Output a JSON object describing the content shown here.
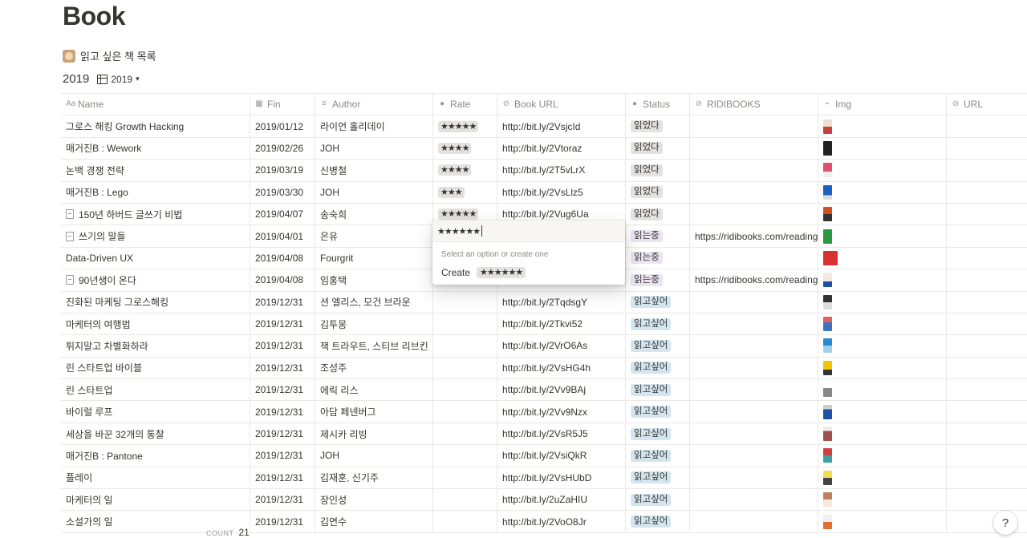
{
  "page": {
    "title": "Book",
    "description": "읽고 싶은 책 목록",
    "view_name": "2019",
    "view_switch": "2019"
  },
  "columns": [
    "Name",
    "Fin",
    "Author",
    "Rate",
    "Book URL",
    "Status",
    "RIDIBOOKS",
    "Img",
    "URL"
  ],
  "header_icons": [
    "text-icon",
    "calendar-icon",
    "text-lines-icon",
    "select-icon",
    "link-icon",
    "select-icon",
    "link-icon",
    "attachment-icon",
    "link-icon"
  ],
  "rows": [
    {
      "name": "그로스 해킹 Growth Hacking",
      "fin": "2019/01/12",
      "author": "라이언 홀리데이",
      "rate": "★★★★★",
      "url": "http://bit.ly/2VsjcId",
      "status": "읽었다",
      "status_type": "read",
      "ridi": "",
      "doc": false
    },
    {
      "name": "매거진B : Wework",
      "fin": "2019/02/26",
      "author": "JOH",
      "rate": "★★★★",
      "url": "http://bit.ly/2Vtoraz",
      "status": "읽었다",
      "status_type": "read",
      "ridi": "",
      "doc": false
    },
    {
      "name": "논백 경쟁 전략",
      "fin": "2019/03/19",
      "author": "신병철",
      "rate": "★★★★",
      "url": "http://bit.ly/2T5vLrX",
      "status": "읽었다",
      "status_type": "read",
      "ridi": "",
      "doc": false
    },
    {
      "name": "매거진B : Lego",
      "fin": "2019/03/30",
      "author": "JOH",
      "rate": "★★★",
      "url": "http://bit.ly/2VsLlz5",
      "status": "읽었다",
      "status_type": "read",
      "ridi": "",
      "doc": false
    },
    {
      "name": "150년 하버드 글쓰기 비법",
      "fin": "2019/04/07",
      "author": "송숙희",
      "rate": "★★★★★",
      "url": "http://bit.ly/2Vug6Ua",
      "status": "읽었다",
      "status_type": "read",
      "ridi": "",
      "doc": true
    },
    {
      "name": "쓰기의 말들",
      "fin": "2019/04/01",
      "author": "은유",
      "rate": "",
      "url": "",
      "status": "읽는중",
      "status_type": "reading",
      "ridi": "https://ridibooks.com/reading",
      "doc": true
    },
    {
      "name": "Data-Driven UX",
      "fin": "2019/04/08",
      "author": "Fourgrit",
      "rate": "",
      "url": "",
      "status": "읽는중",
      "status_type": "reading",
      "ridi": "",
      "doc": false
    },
    {
      "name": "90년생이 온다",
      "fin": "2019/04/08",
      "author": "임홍택",
      "rate": "",
      "url": "",
      "status": "읽는중",
      "status_type": "reading",
      "ridi": "https://ridibooks.com/reading",
      "doc": true
    },
    {
      "name": "진화된 마케팅 그로스해킹",
      "fin": "2019/12/31",
      "author": "션 엘리스, 모건 브라운",
      "rate": "",
      "url": "http://bit.ly/2TqdsgY",
      "status": "읽고싶어",
      "status_type": "want",
      "ridi": "",
      "doc": false
    },
    {
      "name": "마케터의 여행법",
      "fin": "2019/12/31",
      "author": "김투몽",
      "rate": "",
      "url": "http://bit.ly/2Tkvi52",
      "status": "읽고싶어",
      "status_type": "want",
      "ridi": "",
      "doc": false
    },
    {
      "name": "튀지말고 차별화하라",
      "fin": "2019/12/31",
      "author": "잭 트라우트, 스티브 리브킨",
      "rate": "",
      "url": "http://bit.ly/2VrO6As",
      "status": "읽고싶어",
      "status_type": "want",
      "ridi": "",
      "doc": false
    },
    {
      "name": "린 스타트업 바이블",
      "fin": "2019/12/31",
      "author": "조성주",
      "rate": "",
      "url": "http://bit.ly/2VsHG4h",
      "status": "읽고싶어",
      "status_type": "want",
      "ridi": "",
      "doc": false
    },
    {
      "name": "린 스타트업",
      "fin": "2019/12/31",
      "author": "에릭 리스",
      "rate": "",
      "url": "http://bit.ly/2Vv9BAj",
      "status": "읽고싶어",
      "status_type": "want",
      "ridi": "",
      "doc": false
    },
    {
      "name": "바이럴 루프",
      "fin": "2019/12/31",
      "author": "아담 페넨버그",
      "rate": "",
      "url": "http://bit.ly/2Vv9Nzx",
      "status": "읽고싶어",
      "status_type": "want",
      "ridi": "",
      "doc": false
    },
    {
      "name": "세상을 바꾼 32개의 통찰",
      "fin": "2019/12/31",
      "author": "제시카 리빙",
      "rate": "",
      "url": "http://bit.ly/2VsR5J5",
      "status": "읽고싶어",
      "status_type": "want",
      "ridi": "",
      "doc": false
    },
    {
      "name": "매거진B : Pantone",
      "fin": "2019/12/31",
      "author": "JOH",
      "rate": "",
      "url": "http://bit.ly/2VsiQkR",
      "status": "읽고싶어",
      "status_type": "want",
      "ridi": "",
      "doc": false
    },
    {
      "name": "플레이",
      "fin": "2019/12/31",
      "author": "김재훈, 신기주",
      "rate": "",
      "url": "http://bit.ly/2VsHUbD",
      "status": "읽고싶어",
      "status_type": "want",
      "ridi": "",
      "doc": false
    },
    {
      "name": "마케터의 일",
      "fin": "2019/12/31",
      "author": "장인성",
      "rate": "",
      "url": "http://bit.ly/2uZaHIU",
      "status": "읽고싶어",
      "status_type": "want",
      "ridi": "",
      "doc": false
    },
    {
      "name": "소설가의 일",
      "fin": "2019/12/31",
      "author": "김연수",
      "rate": "",
      "url": "http://bit.ly/2VoO8Jr",
      "status": "읽고싶어",
      "status_type": "want",
      "ridi": "",
      "doc": false
    }
  ],
  "popup": {
    "input_value": "★★★★★★",
    "hint": "Select an option or create one",
    "create_label": "Create",
    "create_value": "★★★★★★"
  },
  "footer": {
    "count_label": "COUNT",
    "count": "21"
  },
  "help_label": "?",
  "colors": {
    "read": "#e3e2e0",
    "reading": "#eae4f2",
    "want": "#d3e5ef",
    "text": "#37352f",
    "muted": "#8a8985"
  }
}
